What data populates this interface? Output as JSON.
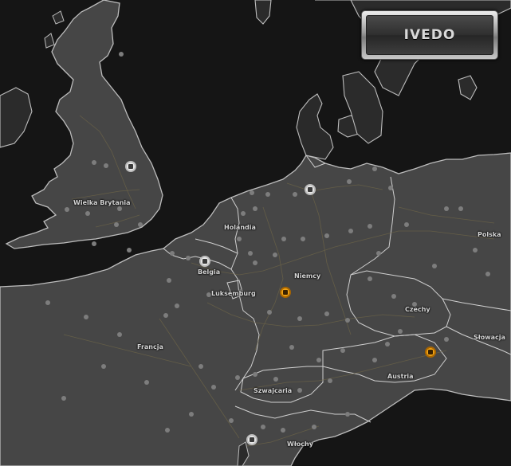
{
  "brand": {
    "label": "IVEDO"
  },
  "countries": [
    {
      "id": "uk",
      "label": "Wielka Brytania"
    },
    {
      "id": "netherlands",
      "label": "Holandia"
    },
    {
      "id": "belgium",
      "label": "Belgia"
    },
    {
      "id": "luxembourg",
      "label": "Luksemburg"
    },
    {
      "id": "germany",
      "label": "Niemcy"
    },
    {
      "id": "poland",
      "label": "Polska"
    },
    {
      "id": "czech",
      "label": "Czechy"
    },
    {
      "id": "slovakia",
      "label": "Słowacja"
    },
    {
      "id": "austria",
      "label": "Austria"
    },
    {
      "id": "france",
      "label": "Francja"
    },
    {
      "id": "switzerland",
      "label": "Szwajcaria"
    },
    {
      "id": "italy",
      "label": "Włochy"
    }
  ],
  "markers": [
    {
      "id": "train-uk",
      "icon": "train-station-icon",
      "kind": "train"
    },
    {
      "id": "train-hamburg",
      "icon": "train-station-icon",
      "kind": "train"
    },
    {
      "id": "train-brussels",
      "icon": "train-station-icon",
      "kind": "train"
    },
    {
      "id": "train-italy",
      "icon": "train-station-icon",
      "kind": "train"
    },
    {
      "id": "garage-germany",
      "icon": "garage-icon",
      "kind": "garage"
    },
    {
      "id": "garage-austria",
      "icon": "garage-icon",
      "kind": "garage"
    }
  ],
  "colors": {
    "land": "#464646",
    "sea": "#151515",
    "border": "#c9c9c9",
    "garage": "#f0a315",
    "train": "#e8e8e8"
  }
}
